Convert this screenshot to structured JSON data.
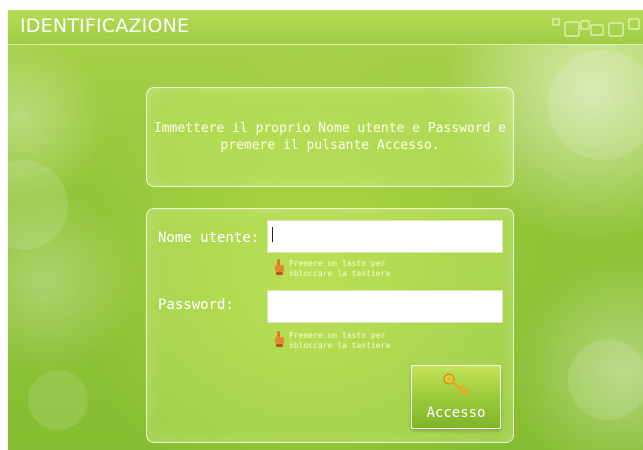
{
  "window": {
    "title": "IDENTIFICAZIONE"
  },
  "message": {
    "line1": "Immettere il proprio Nome utente e Password e",
    "line2": "premere il pulsante Accesso."
  },
  "form": {
    "username": {
      "label": "Nome utente:",
      "value": "",
      "hint_line1": "Premere un tasto per",
      "hint_line2": "sbloccare la tastiera"
    },
    "password": {
      "label": "Password:",
      "value": "",
      "hint_line1": "Premere un tasto per",
      "hint_line2": "sbloccare la tastiera"
    },
    "login_button": {
      "label": "Accesso",
      "icon": "key-icon"
    }
  },
  "colors": {
    "background": "#92c53a",
    "text": "#ffffff",
    "hint_icon": "#e07a1e"
  }
}
